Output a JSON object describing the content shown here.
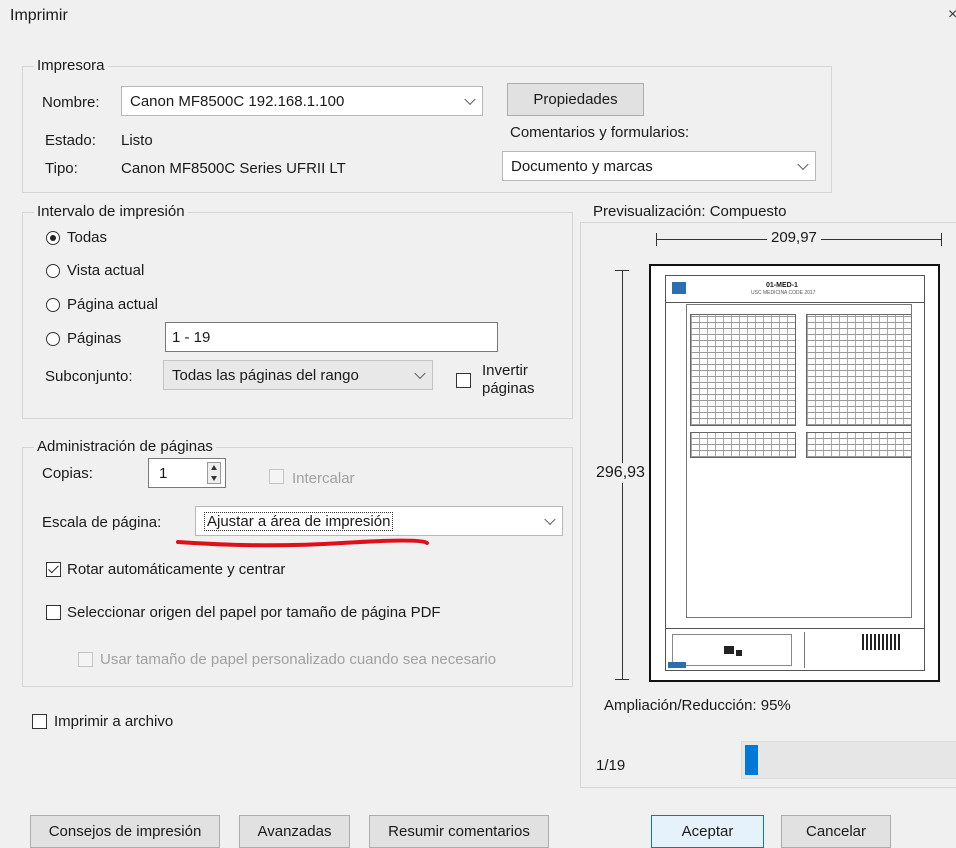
{
  "window": {
    "title": "Imprimir",
    "close": "×"
  },
  "printer": {
    "legend": "Impresora",
    "name_label": "Nombre:",
    "name_value": "Canon MF8500C 192.168.1.100",
    "properties_button": "Propiedades",
    "status_label": "Estado:",
    "status_value": "Listo",
    "type_label": "Tipo:",
    "type_value": "Canon MF8500C Series UFRII LT",
    "comments_label": "Comentarios y formularios:",
    "comments_value": "Documento y marcas"
  },
  "range": {
    "legend": "Intervalo de impresión",
    "options": [
      {
        "label": "Todas",
        "selected": true
      },
      {
        "label": "Vista actual",
        "selected": false
      },
      {
        "label": "Página actual",
        "selected": false
      },
      {
        "label": "Páginas",
        "selected": false
      }
    ],
    "pages_value": "1 - 19",
    "subset_label": "Subconjunto:",
    "subset_value": "Todas las páginas del rango",
    "invert_label_1": "Invertir",
    "invert_label_2": "páginas"
  },
  "page_handling": {
    "legend": "Administración de páginas",
    "copies_label": "Copias:",
    "copies_value": "1",
    "collate_label": "Intercalar",
    "scale_label": "Escala de página:",
    "scale_value": "Ajustar a área de impresión",
    "auto_rotate_label": "Rotar automáticamente y centrar",
    "auto_rotate_checked": true,
    "paper_source_label": "Seleccionar origen del papel por tamaño de página PDF",
    "custom_paper_label": "Usar tamaño de papel personalizado cuando sea necesario"
  },
  "print_to_file_label": "Imprimir a archivo",
  "preview": {
    "title": "Previsualización: Compuesto",
    "width_value": "209,97",
    "height_value": "296,93",
    "zoom_text": "Ampliación/Reducción:  95%",
    "page_indicator": "1/19",
    "doc_header_title": "01-MED-1",
    "doc_header_sub": "USC MEDICINA CODE 2017"
  },
  "buttons": {
    "tips": "Consejos de impresión",
    "advanced": "Avanzadas",
    "summarize": "Resumir comentarios",
    "accept": "Aceptar",
    "cancel": "Cancelar"
  },
  "colors": {
    "accent": "#0078d7",
    "annotation": "#e0101a"
  }
}
